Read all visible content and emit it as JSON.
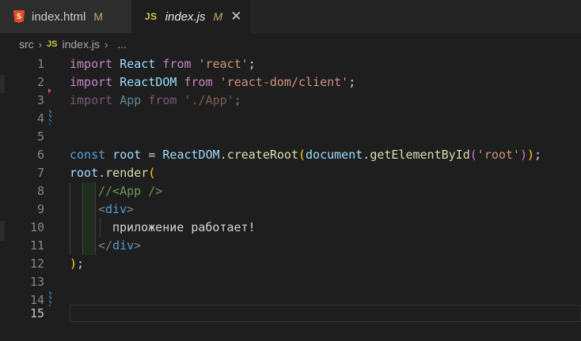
{
  "tabs": [
    {
      "name": "index.html",
      "badge": "M"
    },
    {
      "name": "index.js",
      "badge": "M",
      "close": "✕"
    }
  ],
  "breadcrumb": {
    "folder": "src",
    "js_badge": "JS",
    "file": "index.js",
    "ellipsis": "..."
  },
  "icons": {
    "html5": "html5-icon",
    "js": "js-icon"
  },
  "colors": {
    "keyword": "#c586c0",
    "string": "#ce9178",
    "variable": "#9cdcfe",
    "function": "#dcdcaa",
    "comment": "#6a9955"
  },
  "editor": {
    "active_line": 15,
    "lines": [
      {
        "n": "1",
        "tokens": [
          "import",
          " React ",
          "from",
          " 'react'",
          ";"
        ]
      },
      {
        "n": "2",
        "tokens": [
          "import",
          " ReactDOM ",
          "from",
          " 'react-dom/client'",
          ";"
        ]
      },
      {
        "n": "3",
        "tokens": [
          "import",
          " App ",
          "from",
          " './App'",
          ";"
        ]
      },
      {
        "n": "4",
        "tokens": []
      },
      {
        "n": "5",
        "tokens": []
      },
      {
        "n": "6",
        "tokens": [
          "const",
          " root",
          " = ",
          "ReactDOM",
          ".",
          "createRoot",
          "(",
          "document",
          ".",
          "getElementById",
          "(",
          "'root'",
          ")",
          ")",
          ";"
        ]
      },
      {
        "n": "7",
        "tokens": [
          "root",
          ".",
          "render",
          "("
        ]
      },
      {
        "n": "8",
        "tokens": [
          "//<App />"
        ]
      },
      {
        "n": "9",
        "tokens": [
          "<",
          "div",
          ">"
        ]
      },
      {
        "n": "10",
        "tokens": [
          "приложение работает!"
        ]
      },
      {
        "n": "11",
        "tokens": [
          "</",
          "div",
          ">"
        ]
      },
      {
        "n": "12",
        "tokens": [
          ")",
          ";"
        ]
      },
      {
        "n": "13",
        "tokens": []
      },
      {
        "n": "14",
        "tokens": []
      },
      {
        "n": "15",
        "tokens": []
      }
    ]
  }
}
